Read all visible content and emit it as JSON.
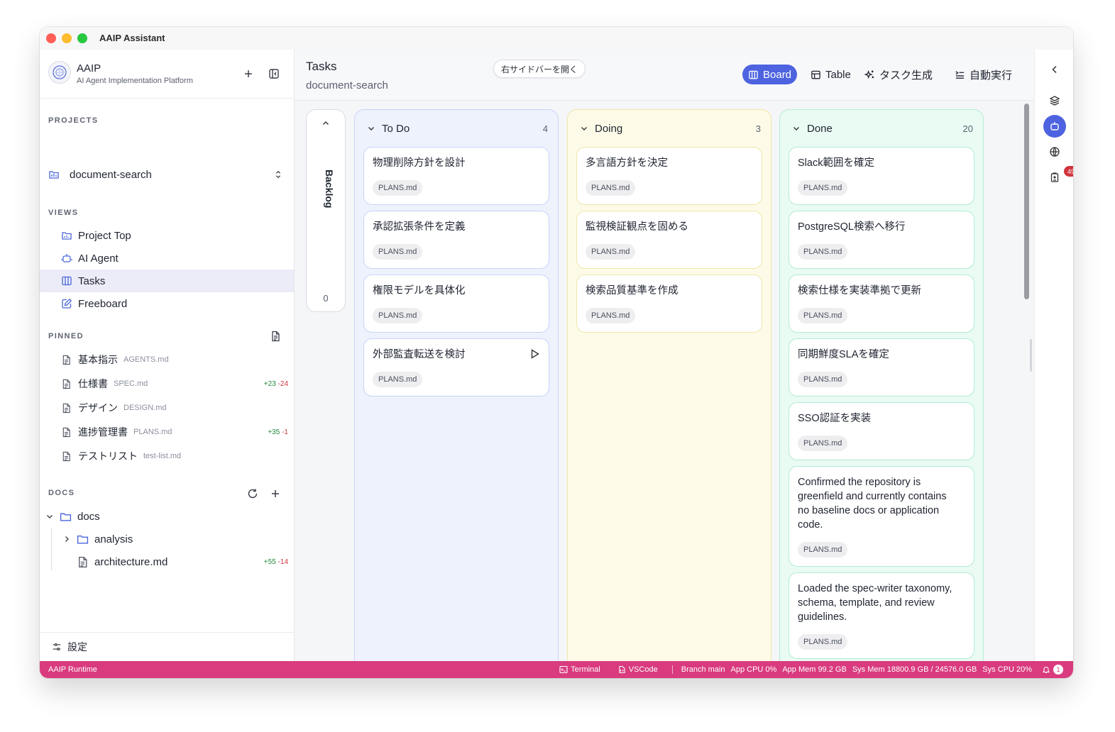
{
  "window": {
    "title": "AAIP Assistant"
  },
  "brand": {
    "name": "AAIP",
    "subtitle": "AI Agent Implementation Platform"
  },
  "sections": {
    "projects": "PROJECTS",
    "views": "VIEWS",
    "pinned": "PINNED",
    "docs": "DOCS"
  },
  "project": {
    "selected": "document-search"
  },
  "views": [
    {
      "label": "Project Top",
      "icon": "project-top-icon",
      "active": false
    },
    {
      "label": "AI Agent",
      "icon": "robot-icon",
      "active": false
    },
    {
      "label": "Tasks",
      "icon": "columns-icon",
      "active": true
    },
    {
      "label": "Freeboard",
      "icon": "edit-icon",
      "active": false
    }
  ],
  "pinned": [
    {
      "name": "基本指示",
      "file": "AGENTS.md",
      "added": "",
      "removed": ""
    },
    {
      "name": "仕様書",
      "file": "SPEC.md",
      "added": "+23",
      "removed": "-24"
    },
    {
      "name": "デザイン",
      "file": "DESIGN.md",
      "added": "",
      "removed": ""
    },
    {
      "name": "進捗管理書",
      "file": "PLANS.md",
      "added": "+35",
      "removed": "-1"
    },
    {
      "name": "テストリスト",
      "file": "test-list.md",
      "added": "",
      "removed": ""
    }
  ],
  "docs": {
    "root": "docs",
    "children": [
      {
        "name": "analysis",
        "type": "folder"
      },
      {
        "name": "architecture.md",
        "type": "file",
        "added": "+55",
        "removed": "-14"
      }
    ]
  },
  "settings": {
    "label": "設定"
  },
  "header": {
    "title": "Tasks",
    "subtitle": "document-search",
    "open_right_sidebar": "右サイドバーを開く",
    "board_label": "Board",
    "table_label": "Table",
    "generate_label": "タスク生成",
    "auto_run_label": "自動実行"
  },
  "backlog": {
    "label": "Backlog",
    "count": "0"
  },
  "columns": [
    {
      "title": "To Do",
      "count": "4",
      "cards": [
        {
          "title": "物理削除方針を設計",
          "tag": "PLANS.md"
        },
        {
          "title": "承認拡張条件を定義",
          "tag": "PLANS.md"
        },
        {
          "title": "権限モデルを具体化",
          "tag": "PLANS.md"
        },
        {
          "title": "外部監査転送を検討",
          "tag": "PLANS.md"
        }
      ]
    },
    {
      "title": "Doing",
      "count": "3",
      "cards": [
        {
          "title": "多言語方針を決定",
          "tag": "PLANS.md"
        },
        {
          "title": "監視検証観点を固める",
          "tag": "PLANS.md"
        },
        {
          "title": "検索品質基準を作成",
          "tag": "PLANS.md"
        }
      ]
    },
    {
      "title": "Done",
      "count": "20",
      "cards": [
        {
          "title": "Slack範囲を確定",
          "tag": "PLANS.md"
        },
        {
          "title": "PostgreSQL検索へ移行",
          "tag": "PLANS.md"
        },
        {
          "title": "検索仕様を実装準拠で更新",
          "tag": "PLANS.md"
        },
        {
          "title": "同期鮮度SLAを確定",
          "tag": "PLANS.md"
        },
        {
          "title": "SSO認証を実装",
          "tag": "PLANS.md"
        },
        {
          "title": "Confirmed the repository is greenfield and currently contains no baseline docs or application code.",
          "tag": "PLANS.md"
        },
        {
          "title": "Loaded the spec-writer taxonomy, schema, template, and review guidelines.",
          "tag": "PLANS.md"
        }
      ]
    }
  ],
  "rail": {
    "badge_count": "49"
  },
  "statusbar": {
    "runtime": "AAIP Runtime",
    "terminal": "Terminal",
    "vscode": "VSCode",
    "branch": "Branch main",
    "app_cpu": "App CPU 0%",
    "app_mem": "App Mem 99.2 GB",
    "sys_mem": "Sys Mem 18800.9 GB / 24576.0 GB",
    "sys_cpu": "Sys CPU 20%",
    "notifications": "1"
  },
  "colors": {
    "accent": "#4d63e0",
    "statusbar": "#d93b7e",
    "todo_bg": "#eef2fd",
    "doing_bg": "#fdfbe8",
    "done_bg": "#e9fbf3",
    "diff_added": "#1f8a3a",
    "diff_removed": "#d1343c"
  }
}
